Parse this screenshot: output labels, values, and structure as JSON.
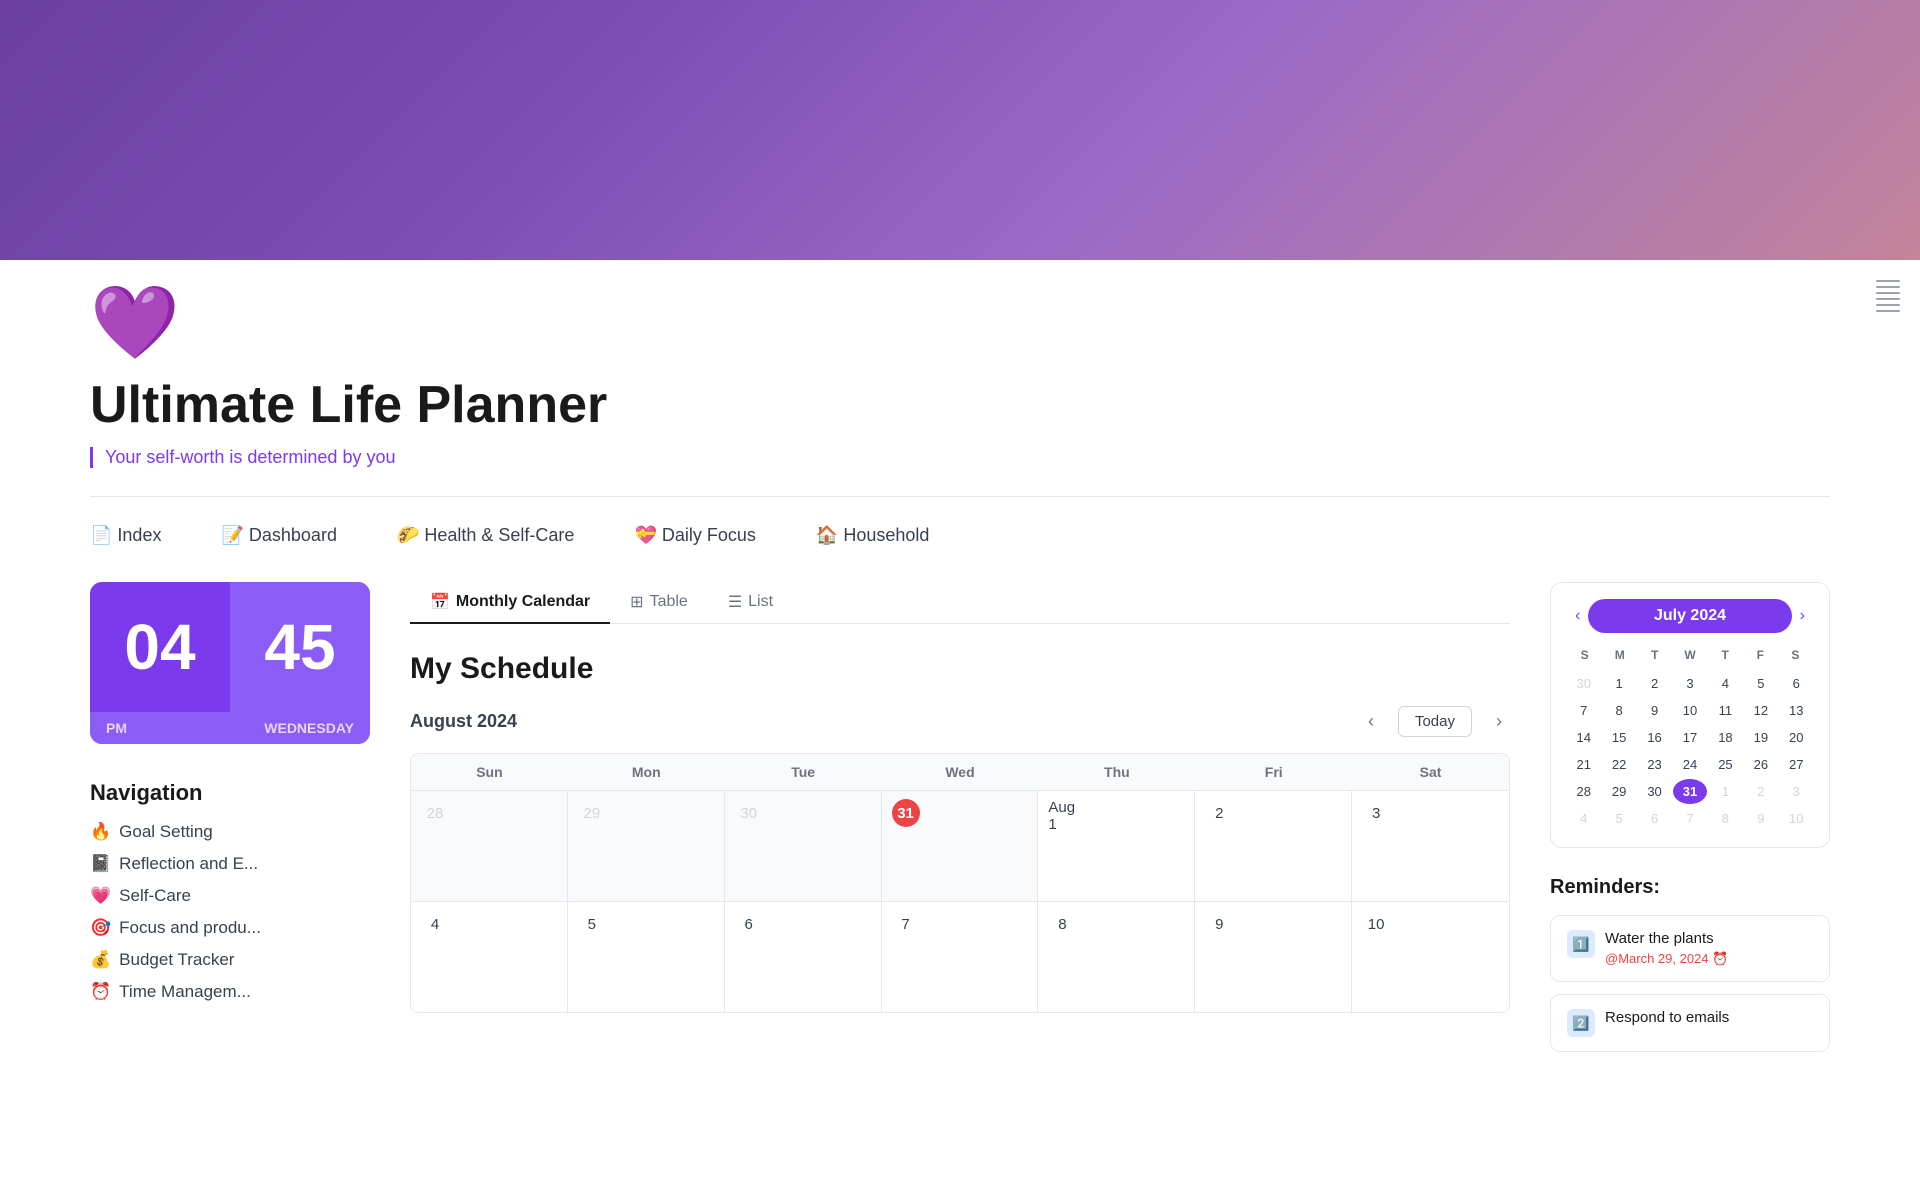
{
  "header": {
    "banner_bg": "linear-gradient(135deg, #6b3fa0, #9b6bc5, #c4849a)",
    "icon": "💜",
    "title": "Ultimate Life Planner",
    "quote": "Your self-worth is determined by you"
  },
  "nav": {
    "items": [
      {
        "emoji": "📄",
        "label": "Index"
      },
      {
        "emoji": "📝",
        "label": "Dashboard"
      },
      {
        "emoji": "🌮",
        "label": "Health & Self-Care"
      },
      {
        "emoji": "💝",
        "label": "Daily Focus"
      },
      {
        "emoji": "🏠",
        "label": "Household"
      }
    ]
  },
  "clock": {
    "hour": "04",
    "minute": "45",
    "ampm": "PM",
    "day": "WEDNESDAY"
  },
  "navigation": {
    "title": "Navigation",
    "items": [
      {
        "emoji": "🔥",
        "label": "Goal Setting"
      },
      {
        "emoji": "📓",
        "label": "Reflection and E..."
      },
      {
        "emoji": "💗",
        "label": "Self-Care"
      },
      {
        "emoji": "🎯",
        "label": "Focus and produ..."
      },
      {
        "emoji": "💰",
        "label": "Budget Tracker"
      },
      {
        "emoji": "⏰",
        "label": "Time Managem..."
      }
    ]
  },
  "tabs": [
    {
      "id": "monthly",
      "label": "Monthly Calendar",
      "emoji": "📅",
      "active": true
    },
    {
      "id": "table",
      "label": "Table",
      "emoji": "⊞",
      "active": false
    },
    {
      "id": "list",
      "label": "List",
      "emoji": "☰",
      "active": false
    }
  ],
  "schedule": {
    "title": "My Schedule",
    "month_label": "August 2024",
    "today_btn": "Today",
    "day_headers": [
      "Sun",
      "Mon",
      "Tue",
      "Wed",
      "Thu",
      "Fri",
      "Sat"
    ],
    "rows": [
      {
        "cells": [
          {
            "date": "28",
            "type": "other"
          },
          {
            "date": "29",
            "type": "other"
          },
          {
            "date": "30",
            "type": "other"
          },
          {
            "date": "31",
            "type": "today"
          },
          {
            "date": "Aug 1",
            "type": "normal"
          },
          {
            "date": "2",
            "type": "normal"
          },
          {
            "date": "3",
            "type": "normal"
          }
        ]
      },
      {
        "cells": [
          {
            "date": "4",
            "type": "normal"
          },
          {
            "date": "5",
            "type": "normal"
          },
          {
            "date": "6",
            "type": "normal"
          },
          {
            "date": "7",
            "type": "normal"
          },
          {
            "date": "8",
            "type": "normal"
          },
          {
            "date": "9",
            "type": "normal"
          },
          {
            "date": "10",
            "type": "normal"
          }
        ]
      }
    ]
  },
  "mini_calendar": {
    "title": "July 2024",
    "prev_btn": "‹",
    "next_btn": "›",
    "day_headers": [
      "S",
      "M",
      "T",
      "W",
      "T",
      "F",
      "S"
    ],
    "rows": [
      [
        "30",
        "1",
        "2",
        "3",
        "4",
        "5",
        "6"
      ],
      [
        "7",
        "8",
        "9",
        "10",
        "11",
        "12",
        "13"
      ],
      [
        "14",
        "15",
        "16",
        "17",
        "18",
        "19",
        "20"
      ],
      [
        "21",
        "22",
        "23",
        "24",
        "25",
        "26",
        "27"
      ],
      [
        "28",
        "29",
        "30",
        "31",
        "1",
        "2",
        "3"
      ],
      [
        "4",
        "5",
        "6",
        "7",
        "8",
        "9",
        "10"
      ]
    ],
    "today_date": "31",
    "other_month_start": [
      "30"
    ],
    "other_month_end": [
      "1",
      "2",
      "3",
      "4",
      "5",
      "6",
      "7",
      "8",
      "9",
      "10"
    ]
  },
  "reminders": {
    "title": "Reminders:",
    "items": [
      {
        "icon": "1️⃣",
        "text": "Water the plants",
        "date": "@March 29, 2024 ⏰",
        "icon_bg": "#dbeafe"
      },
      {
        "icon": "2️⃣",
        "text": "Respond to emails",
        "date": "",
        "icon_bg": "#dbeafe"
      }
    ]
  }
}
